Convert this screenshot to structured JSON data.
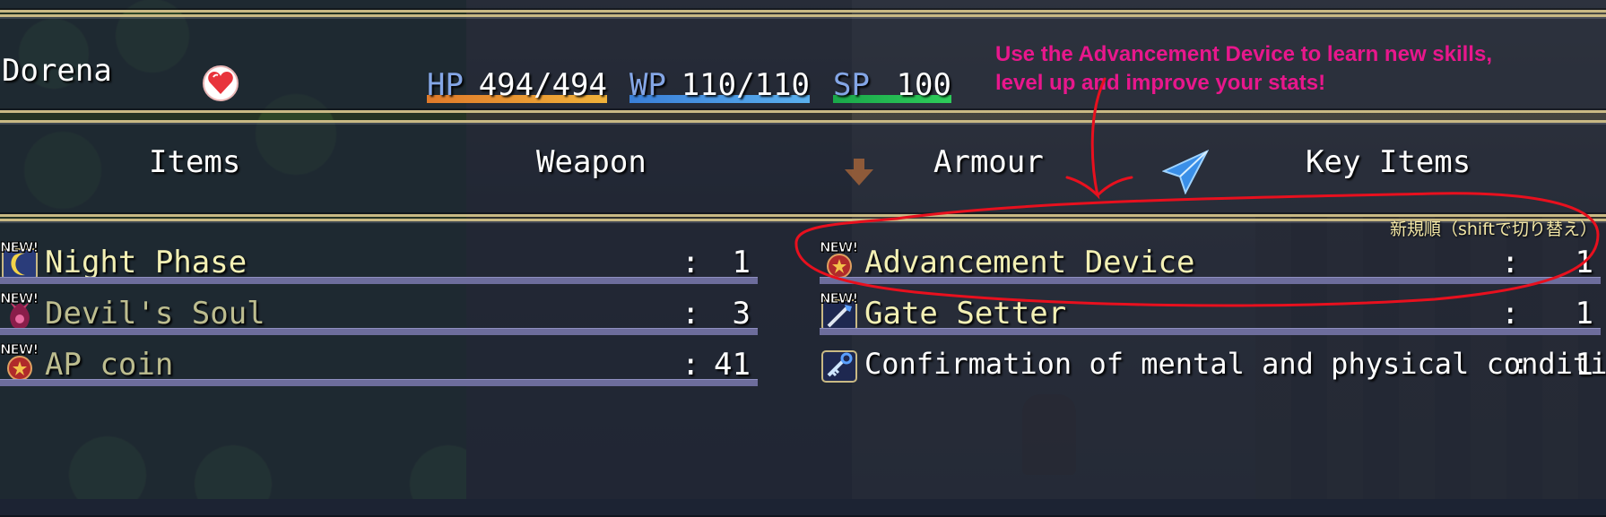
{
  "actor": {
    "name": "Dorena",
    "state_icon": "heart-icon"
  },
  "gauges": {
    "hp": {
      "label": "HP",
      "value": "494/494",
      "fill": 1.0,
      "color_start": "#e07a2a",
      "color_end": "#f0b23a"
    },
    "wp": {
      "label": "WP",
      "value": "110/110",
      "fill": 1.0,
      "color_start": "#3a7fd8",
      "color_end": "#5ab0ee"
    },
    "sp": {
      "label": "SP",
      "value": "100",
      "fill": 1.0,
      "color_start": "#1aa84a",
      "color_end": "#2ecc5a"
    }
  },
  "tip": {
    "line1": "Use the Advancement Device to learn new skills,",
    "line2": "level up and improve your stats!",
    "color": "#e8178c"
  },
  "tabs": [
    {
      "label": "Items"
    },
    {
      "label": "Weapon"
    },
    {
      "label": "Armour"
    },
    {
      "label": "Key Items"
    }
  ],
  "sort": {
    "label": "新規順（shiftで切り替え）"
  },
  "left_items": [
    {
      "badge": "NEW!",
      "icon": "moon-icon",
      "name": "Night Phase",
      "separator": ":",
      "qty": "1"
    },
    {
      "badge": "NEW!",
      "icon": "devil-soul-icon",
      "name": "Devil's Soul",
      "separator": ":",
      "qty": "3"
    },
    {
      "badge": "NEW!",
      "icon": "coin-icon",
      "name": "AP coin",
      "separator": ":",
      "qty": "41"
    }
  ],
  "right_items": [
    {
      "badge": "NEW!",
      "icon": "medal-icon",
      "name": "Advancement Device",
      "separator": ":",
      "qty": "1"
    },
    {
      "badge": "NEW!",
      "icon": "gate-wand-icon",
      "name": "Gate Setter",
      "separator": ":",
      "qty": "1"
    },
    {
      "badge": "",
      "icon": "key-icon",
      "name": "Confirmation of mental and physical condition",
      "separator": ":",
      "qty": "1"
    }
  ],
  "colors": {
    "window_border": "#c9b984",
    "annotation": "#e8101e"
  }
}
